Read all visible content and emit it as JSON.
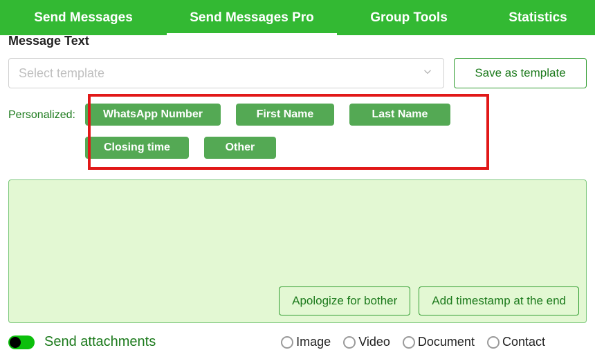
{
  "nav": {
    "send_messages": "Send Messages",
    "send_messages_pro": "Send Messages Pro",
    "group_tools": "Group Tools",
    "statistics": "Statistics"
  },
  "section_title": "Message Text",
  "template_select": {
    "placeholder": "Select template"
  },
  "save_template": "Save as template",
  "personalized_label": "Personalized:",
  "chips": {
    "whatsapp_number": "WhatsApp Number",
    "first_name": "First Name",
    "last_name": "Last Name",
    "closing_time": "Closing time",
    "other": "Other"
  },
  "editor_buttons": {
    "apologize": "Apologize for bother",
    "timestamp": "Add timestamp at the end"
  },
  "attachments": {
    "toggle_label": "Send attachments",
    "image": "Image",
    "video": "Video",
    "document": "Document",
    "contact": "Contact"
  }
}
